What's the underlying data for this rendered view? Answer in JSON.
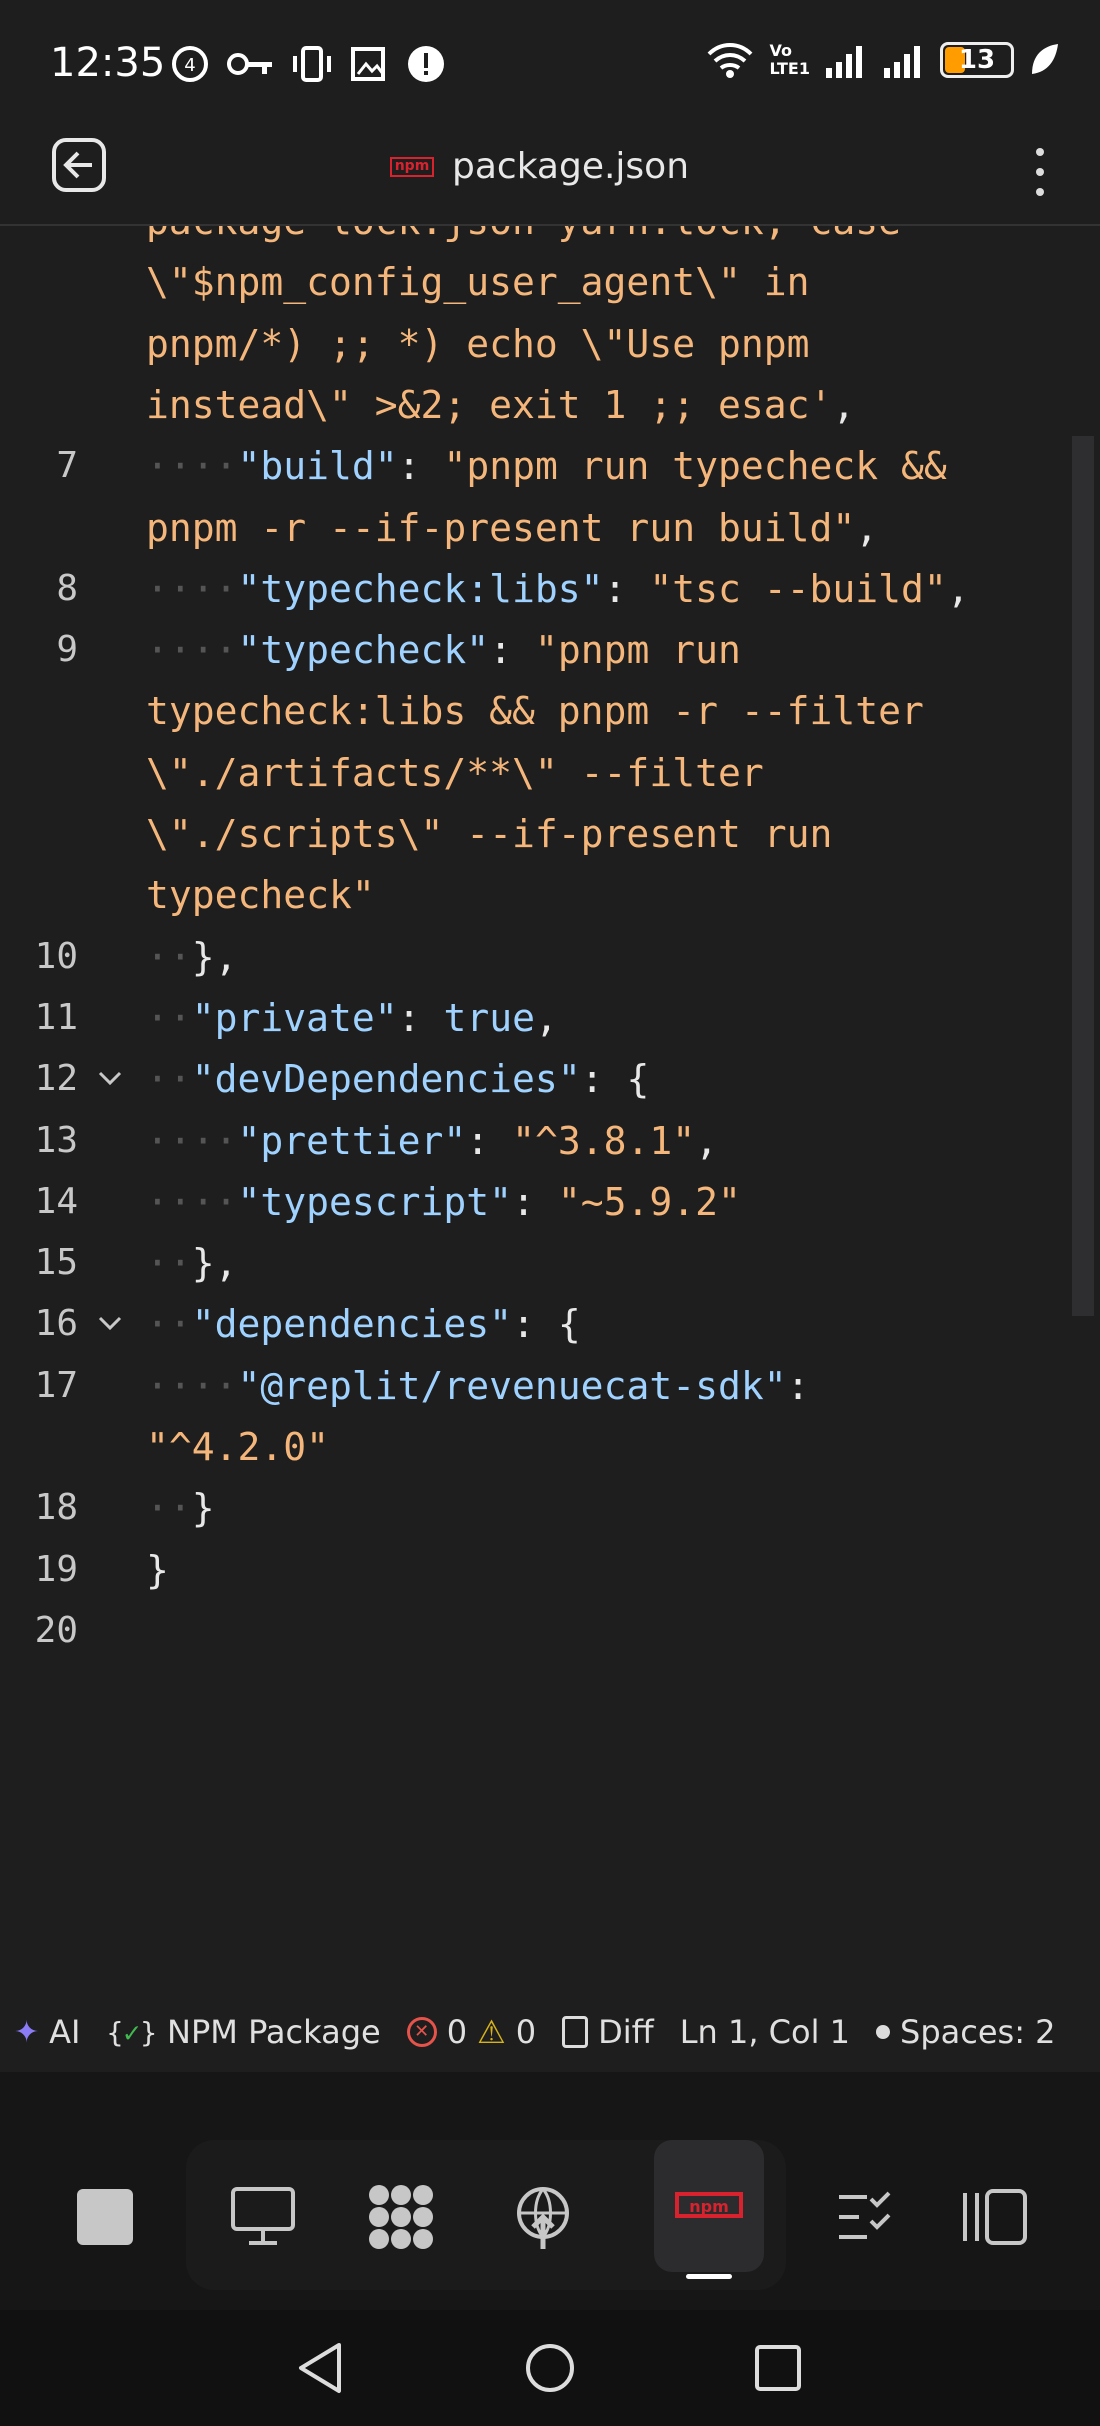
{
  "status_bar": {
    "time": "12:35",
    "battery": "13",
    "network_label_1": "Vo",
    "network_label_2": "LTE1"
  },
  "app_bar": {
    "title": "package.json",
    "file_type_badge": "npm"
  },
  "editor": {
    "lines": [
      {
        "number": "",
        "segments": [
          {
            "t": "s",
            "v": "package-lock.json yarn.lock; case"
          }
        ]
      },
      {
        "number": "",
        "segments": [
          {
            "t": "s",
            "v": "\\\"$npm_config_user_agent\\\" in"
          }
        ]
      },
      {
        "number": "",
        "segments": [
          {
            "t": "s",
            "v": "pnpm/*) ;; *) echo \\\"Use pnpm"
          }
        ]
      },
      {
        "number": "",
        "segments": [
          {
            "t": "s",
            "v": "instead\\\" >&2; exit 1 ;; esac'"
          },
          {
            "t": "p",
            "v": ","
          }
        ]
      },
      {
        "number": "7",
        "segments": [
          {
            "t": "dot",
            "v": "····"
          },
          {
            "t": "k",
            "v": "\"build\""
          },
          {
            "t": "p",
            "v": ": "
          },
          {
            "t": "s",
            "v": "\"pnpm run typecheck &&"
          }
        ]
      },
      {
        "number": "",
        "segments": [
          {
            "t": "s",
            "v": "pnpm -r --if-present run build\""
          },
          {
            "t": "p",
            "v": ","
          }
        ]
      },
      {
        "number": "8",
        "segments": [
          {
            "t": "dot",
            "v": "····"
          },
          {
            "t": "k",
            "v": "\"typecheck:libs\""
          },
          {
            "t": "p",
            "v": ": "
          },
          {
            "t": "s",
            "v": "\"tsc --build\""
          },
          {
            "t": "p",
            "v": ","
          }
        ]
      },
      {
        "number": "9",
        "segments": [
          {
            "t": "dot",
            "v": "····"
          },
          {
            "t": "k",
            "v": "\"typecheck\""
          },
          {
            "t": "p",
            "v": ": "
          },
          {
            "t": "s",
            "v": "\"pnpm run"
          }
        ]
      },
      {
        "number": "",
        "segments": [
          {
            "t": "s",
            "v": "typecheck:libs && pnpm -r --filter"
          }
        ]
      },
      {
        "number": "",
        "segments": [
          {
            "t": "s",
            "v": "\\\"./artifacts/**\\\" --filter"
          }
        ]
      },
      {
        "number": "",
        "segments": [
          {
            "t": "s",
            "v": "\\\"./scripts\\\" --if-present run"
          }
        ]
      },
      {
        "number": "",
        "segments": [
          {
            "t": "s",
            "v": "typecheck\""
          }
        ]
      },
      {
        "number": "10",
        "segments": [
          {
            "t": "dot",
            "v": "··"
          },
          {
            "t": "p",
            "v": "},"
          }
        ]
      },
      {
        "number": "11",
        "segments": [
          {
            "t": "dot",
            "v": "··"
          },
          {
            "t": "k",
            "v": "\"private\""
          },
          {
            "t": "p",
            "v": ": "
          },
          {
            "t": "b",
            "v": "true"
          },
          {
            "t": "p",
            "v": ","
          }
        ]
      },
      {
        "number": "12",
        "fold": true,
        "segments": [
          {
            "t": "dot",
            "v": "··"
          },
          {
            "t": "k",
            "v": "\"devDependencies\""
          },
          {
            "t": "p",
            "v": ": {"
          }
        ]
      },
      {
        "number": "13",
        "segments": [
          {
            "t": "dot",
            "v": "····"
          },
          {
            "t": "k",
            "v": "\"prettier\""
          },
          {
            "t": "p",
            "v": ": "
          },
          {
            "t": "s",
            "v": "\"^3.8.1\""
          },
          {
            "t": "p",
            "v": ","
          }
        ]
      },
      {
        "number": "14",
        "segments": [
          {
            "t": "dot",
            "v": "····"
          },
          {
            "t": "k",
            "v": "\"typescript\""
          },
          {
            "t": "p",
            "v": ": "
          },
          {
            "t": "s",
            "v": "\"~5.9.2\""
          }
        ]
      },
      {
        "number": "15",
        "segments": [
          {
            "t": "dot",
            "v": "··"
          },
          {
            "t": "p",
            "v": "},"
          }
        ]
      },
      {
        "number": "16",
        "fold": true,
        "segments": [
          {
            "t": "dot",
            "v": "··"
          },
          {
            "t": "k",
            "v": "\"dependencies\""
          },
          {
            "t": "p",
            "v": ": {"
          }
        ]
      },
      {
        "number": "17",
        "segments": [
          {
            "t": "dot",
            "v": "····"
          },
          {
            "t": "k",
            "v": "\"@replit/revenuecat-sdk\""
          },
          {
            "t": "p",
            "v": ":"
          }
        ]
      },
      {
        "number": "",
        "segments": [
          {
            "t": "s",
            "v": "\"^4.2.0\""
          }
        ]
      },
      {
        "number": "18",
        "segments": [
          {
            "t": "dot",
            "v": "··"
          },
          {
            "t": "p",
            "v": "}"
          }
        ]
      },
      {
        "number": "19",
        "segments": [
          {
            "t": "p",
            "v": "}"
          }
        ]
      },
      {
        "number": "20",
        "segments": []
      }
    ]
  },
  "status_strip": {
    "ai_label": "AI",
    "language_label": "NPM Package",
    "errors": "0",
    "warnings": "0",
    "diff_label": "Diff",
    "cursor": "Ln 1, Col 1",
    "spaces": "Spaces: 2"
  },
  "dock": {
    "items": [
      "stop",
      "console",
      "workflows",
      "deploy",
      "npm",
      "tasks",
      "panels"
    ],
    "active": "npm"
  },
  "colors": {
    "background": "#1e1e1f",
    "string": "#f4b67a",
    "key": "#9fd2ff",
    "npm_red": "#d8232f"
  }
}
